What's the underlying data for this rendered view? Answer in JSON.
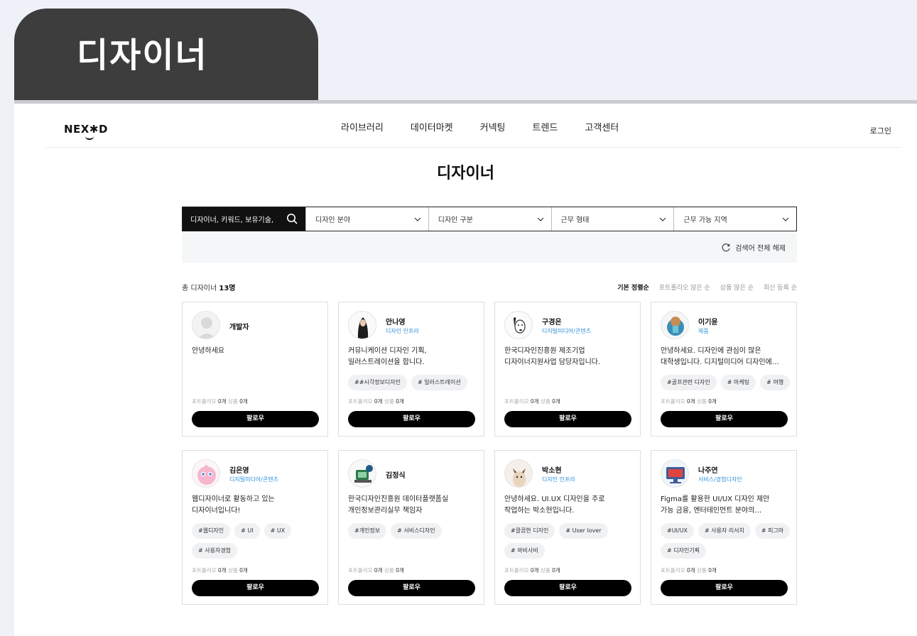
{
  "outer_title": "디자이너",
  "header": {
    "logo": "NEX",
    "logo_mark": "✱",
    "logo_end": "D",
    "nav": [
      "라이브러리",
      "데이터마켓",
      "커넥팅",
      "트렌드",
      "고객센터"
    ],
    "login": "로그인"
  },
  "page_title": "디자이너",
  "filters": {
    "search_placeholder": "디자이너, 키워드, 보유기술,",
    "dropdowns": [
      "디자인 분야",
      "디자인 구분",
      "근무 형태",
      "근무 가능 지역"
    ],
    "reset": "검색어 전체 해제"
  },
  "count": {
    "prefix": "총 디자이너 ",
    "num": "13명"
  },
  "sort": [
    "기본 정렬순",
    "포트폴리오 많은 순",
    "상품 많은 순",
    "최신 등록 순"
  ],
  "cards": [
    {
      "name": "개발자",
      "role": "",
      "desc": "안녕하세요",
      "tags": [],
      "portfolio": "포트폴리오 ",
      "pcount": "0개",
      "products": "상품 ",
      "prcount": "0개",
      "follow": "팔로우",
      "avatar": "default"
    },
    {
      "name": "안나영",
      "role": "디자인 인프라",
      "desc": "커뮤니케이션 디자인 기획,\n일러스트레이션을 합니다.",
      "tags": [
        "##시각정보디자인",
        "# 일러스트레이션"
      ],
      "portfolio": "포트폴리오 ",
      "pcount": "0개",
      "products": "상품 ",
      "prcount": "0개",
      "follow": "팔로우",
      "avatar": "woman"
    },
    {
      "name": "구경은",
      "role": "디지털미디어/콘텐츠",
      "desc": "한국디자인진흥원 제조기업\n디자이너지원사업 담당자입니다.",
      "tags": [],
      "portfolio": "포트폴리오 ",
      "pcount": "0개",
      "products": "상품 ",
      "prcount": "0개",
      "follow": "팔로우",
      "avatar": "dog"
    },
    {
      "name": "이기윤",
      "role": "제품",
      "desc": "안녕하세요. 디자인에 관심이 많은\n대학생입니다. 디지털미디어 디자인에…",
      "tags": [
        "#골프관련 디자인",
        "# 마케팅",
        "# 여행"
      ],
      "portfolio": "포트폴리오 ",
      "pcount": "0개",
      "products": "상품 ",
      "prcount": "0개",
      "follow": "팔로우",
      "avatar": "char"
    },
    {
      "name": "김은영",
      "role": "디지털미디어/콘텐츠",
      "desc": "웹디자이너로 활동하고 있는\n디자이너입니다!",
      "tags": [
        "#웹디자인",
        "# UI",
        "# UX",
        "# 사용자경험"
      ],
      "portfolio": "포트폴리오 ",
      "pcount": "0개",
      "products": "상품 ",
      "prcount": "0개",
      "follow": "팔로우",
      "avatar": "pink"
    },
    {
      "name": "김정식",
      "role": "",
      "desc": "한국디자인진흥원 데이터플랫폼실\n개인정보관리실무 책임자",
      "tags": [
        "#개인정보",
        "# 서비스디자인"
      ],
      "portfolio": "포트폴리오 ",
      "pcount": "0개",
      "products": "상품 ",
      "prcount": "0개",
      "follow": "팔로우",
      "avatar": "pc"
    },
    {
      "name": "박소현",
      "role": "디자인 인프라",
      "desc": "안녕하세요. UI.UX 디자인을 주로\n작업하는 박소현입니다.",
      "tags": [
        "#깔끔한 디자인",
        "# User lover",
        "# 와비사비"
      ],
      "portfolio": "포트폴리오 ",
      "pcount": "0개",
      "products": "상품 ",
      "prcount": "0개",
      "follow": "팔로우",
      "avatar": "cat"
    },
    {
      "name": "나주연",
      "role": "서비스/경험디자인",
      "desc": "Figma를 활용한 UI/UX 디자인 제안\n가능 금융, 엔터테인먼트 분야의…",
      "tags": [
        "#UI/UX",
        "# 사용자 리서치",
        "# 피그마",
        "# 디자인기획"
      ],
      "portfolio": "포트폴리오 ",
      "pcount": "0개",
      "products": "상품 ",
      "prcount": "0개",
      "follow": "팔로우",
      "avatar": "screen"
    }
  ]
}
